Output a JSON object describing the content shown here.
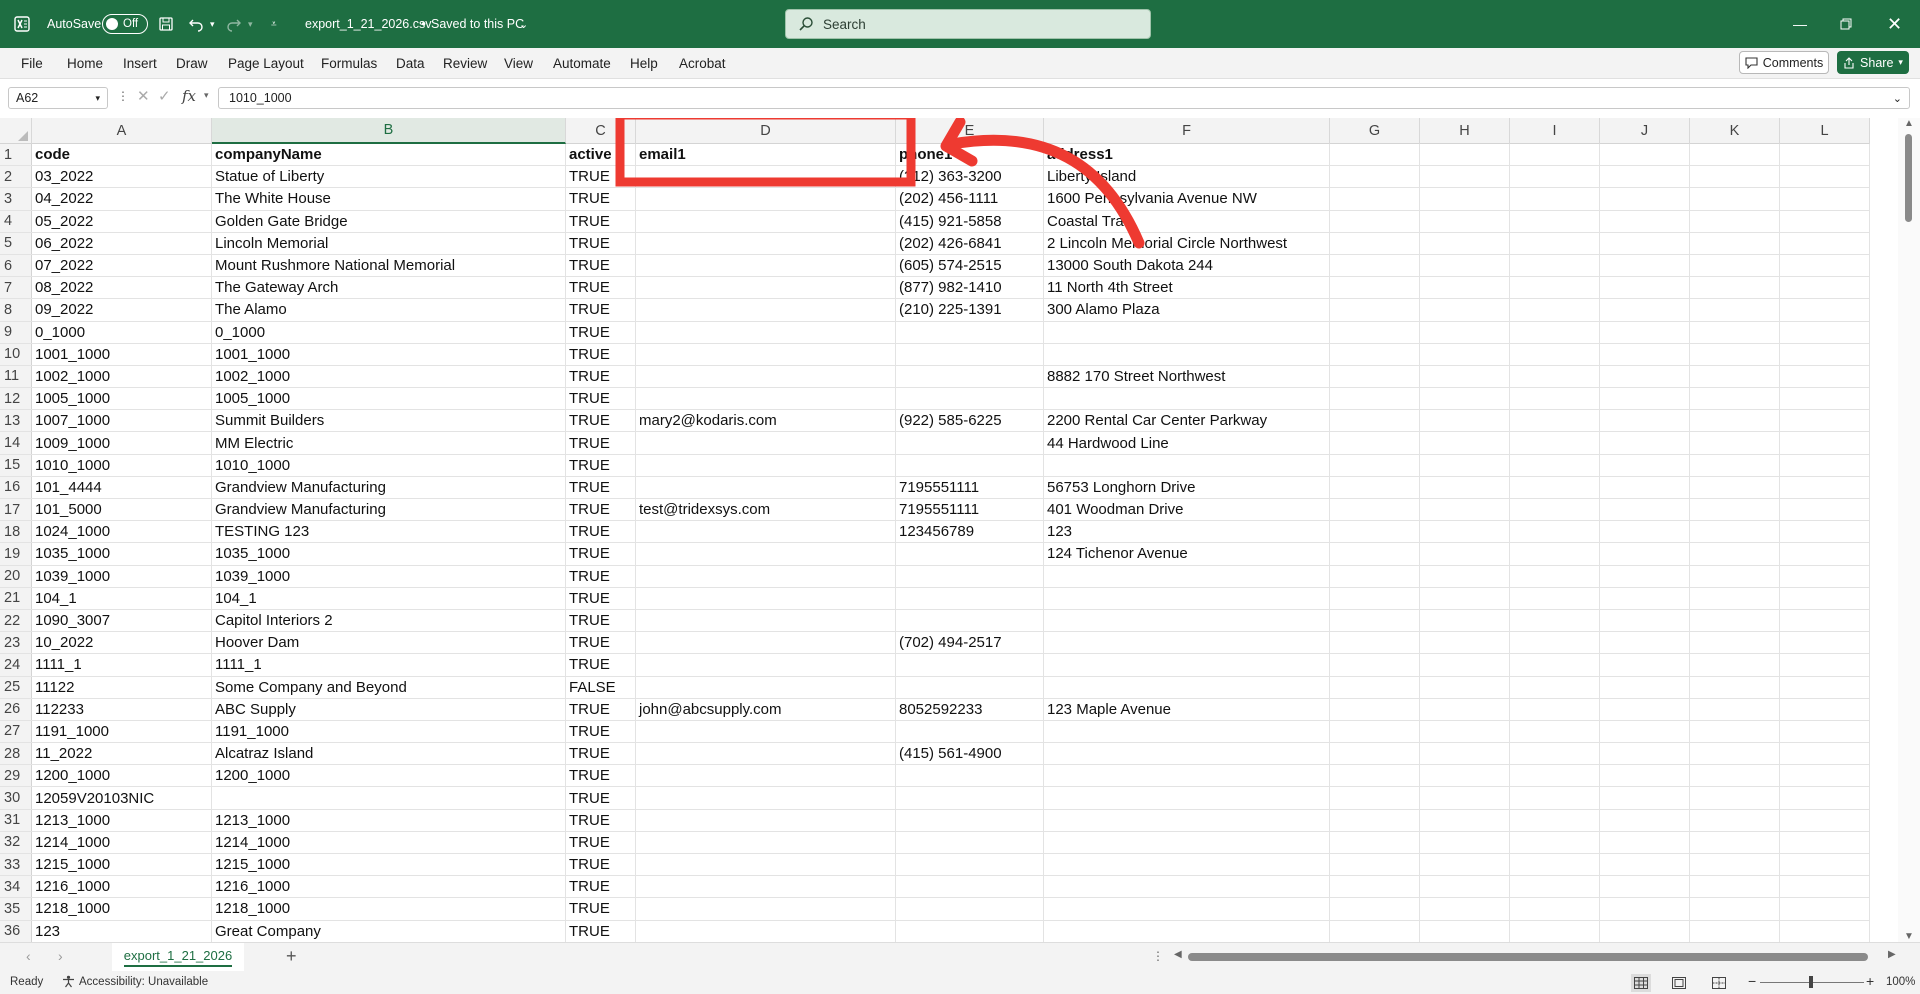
{
  "titlebar": {
    "autosave_label": "AutoSave",
    "autosave_state": "Off",
    "file_name": "export_1_21_2026.csv",
    "save_status": "Saved to this PC",
    "search_placeholder": "Search"
  },
  "ribbon": {
    "tabs": [
      "File",
      "Home",
      "Insert",
      "Draw",
      "Page Layout",
      "Formulas",
      "Data",
      "Review",
      "View",
      "Automate",
      "Help",
      "Acrobat"
    ],
    "comments_label": "Comments",
    "share_label": "Share"
  },
  "formula_bar": {
    "name_box": "A62",
    "fx_label": "fx",
    "value": "1010_1000"
  },
  "sheet": {
    "columns": [
      "A",
      "B",
      "C",
      "D",
      "E",
      "F",
      "G",
      "H",
      "I",
      "J",
      "K",
      "L"
    ],
    "rows": [
      [
        "code",
        "companyName",
        "active",
        "email1",
        "phone1",
        "address1"
      ],
      [
        "03_2022",
        "Statue of Liberty",
        "TRUE",
        "",
        "(212) 363-3200",
        "Liberty Island"
      ],
      [
        "04_2022",
        "The White House",
        "TRUE",
        "",
        "(202) 456-1111",
        "1600 Pennsylvania Avenue NW"
      ],
      [
        "05_2022",
        "Golden Gate Bridge",
        "TRUE",
        "",
        "(415) 921-5858",
        "Coastal Trail"
      ],
      [
        "06_2022",
        "Lincoln Memorial",
        "TRUE",
        "",
        "(202) 426-6841",
        "2 Lincoln Memorial Circle Northwest"
      ],
      [
        "07_2022",
        "Mount Rushmore National Memorial",
        "TRUE",
        "",
        "(605) 574-2515",
        "13000 South Dakota 244"
      ],
      [
        "08_2022",
        "The Gateway Arch",
        "TRUE",
        "",
        "(877) 982-1410",
        "11 North 4th Street"
      ],
      [
        "09_2022",
        "The Alamo",
        "TRUE",
        "",
        "(210) 225-1391",
        "300 Alamo Plaza"
      ],
      [
        "0_1000",
        "0_1000",
        "TRUE",
        "",
        "",
        ""
      ],
      [
        "1001_1000",
        "1001_1000",
        "TRUE",
        "",
        "",
        ""
      ],
      [
        "1002_1000",
        "1002_1000",
        "TRUE",
        "",
        "",
        "8882 170 Street Northwest"
      ],
      [
        "1005_1000",
        "1005_1000",
        "TRUE",
        "",
        "",
        ""
      ],
      [
        "1007_1000",
        "Summit Builders",
        "TRUE",
        "mary2@kodaris.com",
        "(922) 585-6225",
        "2200 Rental Car Center Parkway"
      ],
      [
        "1009_1000",
        "MM Electric",
        "TRUE",
        "",
        "",
        "44 Hardwood Line"
      ],
      [
        "1010_1000",
        "1010_1000",
        "TRUE",
        "",
        "",
        ""
      ],
      [
        "101_4444",
        "Grandview Manufacturing",
        "TRUE",
        "",
        "7195551111",
        "56753 Longhorn Drive"
      ],
      [
        "101_5000",
        "Grandview Manufacturing",
        "TRUE",
        "test@tridexsys.com",
        "7195551111",
        "401 Woodman Drive"
      ],
      [
        "1024_1000",
        "TESTING 123",
        "TRUE",
        "",
        "123456789",
        "123"
      ],
      [
        "1035_1000",
        "1035_1000",
        "TRUE",
        "",
        "",
        "124 Tichenor Avenue"
      ],
      [
        "1039_1000",
        "1039_1000",
        "TRUE",
        "",
        "",
        ""
      ],
      [
        "104_1",
        "104_1",
        "TRUE",
        "",
        "",
        ""
      ],
      [
        "1090_3007",
        "Capitol Interiors 2",
        "TRUE",
        "",
        "",
        ""
      ],
      [
        "10_2022",
        "Hoover Dam",
        "TRUE",
        "",
        "(702) 494-2517",
        ""
      ],
      [
        "1111_1",
        "1111_1",
        "TRUE",
        "",
        "",
        ""
      ],
      [
        "11122",
        "Some Company and Beyond",
        "FALSE",
        "",
        "",
        ""
      ],
      [
        "112233",
        "ABC Supply",
        "TRUE",
        "john@abcsupply.com",
        "8052592233",
        "123 Maple Avenue"
      ],
      [
        "1191_1000",
        "1191_1000",
        "TRUE",
        "",
        "",
        ""
      ],
      [
        "11_2022",
        "Alcatraz Island",
        "TRUE",
        "",
        "(415) 561-4900",
        ""
      ],
      [
        "1200_1000",
        "1200_1000",
        "TRUE",
        "",
        "",
        ""
      ],
      [
        "12059V20103NIC",
        "",
        "TRUE",
        "",
        "",
        ""
      ],
      [
        "1213_1000",
        "1213_1000",
        "TRUE",
        "",
        "",
        ""
      ],
      [
        "1214_1000",
        "1214_1000",
        "TRUE",
        "",
        "",
        ""
      ],
      [
        "1215_1000",
        "1215_1000",
        "TRUE",
        "",
        "",
        ""
      ],
      [
        "1216_1000",
        "1216_1000",
        "TRUE",
        "",
        "",
        ""
      ],
      [
        "1218_1000",
        "1218_1000",
        "TRUE",
        "",
        "",
        ""
      ],
      [
        "123",
        "Great Company",
        "TRUE",
        "",
        "",
        ""
      ]
    ]
  },
  "sheet_tabs": {
    "active_tab": "export_1_21_2026",
    "add_label": "+"
  },
  "status_bar": {
    "ready": "Ready",
    "accessibility": "Accessibility: Unavailable",
    "zoom": "100%"
  },
  "colors": {
    "brand": "#1e6e42",
    "annotation": "#ee3a31"
  }
}
